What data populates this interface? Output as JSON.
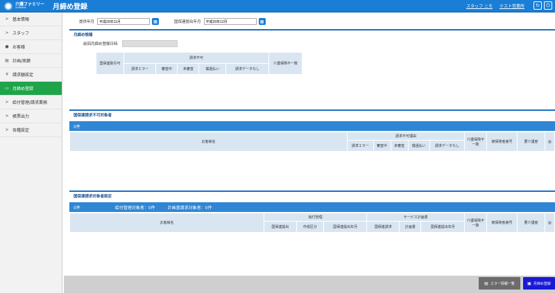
{
  "header": {
    "logo_brand": "介護ファミリー",
    "logo_sub": "Softbank",
    "title": "月締め登録",
    "user_link": "スタッフ ニモ",
    "office_link": "テスト営業所",
    "icons": [
      "refresh-icon",
      "power-icon"
    ]
  },
  "sidebar": {
    "items": [
      {
        "icon": ">",
        "label": "基本情報"
      },
      {
        "icon": ">",
        "label": "スタッフ"
      },
      {
        "icon": "●",
        "label": "お客様"
      },
      {
        "icon": "▤",
        "label": "計画/実績"
      },
      {
        "icon": "¥",
        "label": "請求額設定"
      },
      {
        "icon": "▭",
        "label": "月締め登録"
      },
      {
        "icon": ">",
        "label": "給付管理/請求業務"
      },
      {
        "icon": ">",
        "label": "帳票出力"
      },
      {
        "icon": ">",
        "label": "各種設定"
      }
    ],
    "active_index": 5
  },
  "filters": {
    "service_month_label": "提供年月",
    "service_month_value": "平成29年11月",
    "submit_month_label": "国保連提出年月",
    "submit_month_value": "平成29年12月"
  },
  "section1": {
    "title": "月締め情報",
    "last_close_label": "前回月締め登録日時",
    "last_close_value": "",
    "col_kokuho": "国保連取引可",
    "col_seikyu_fuka": "請求不可",
    "sub_cols": [
      "請求エラー",
      "審査中",
      "未審査",
      "償還払い",
      "請求データなし"
    ],
    "col_kaigo_mismatch": "介護保険不一致"
  },
  "section2": {
    "title": "国保連請求不可対象者",
    "count_label": "0件",
    "col_customer": "お客様名",
    "col_reason": "請求不可理由",
    "sub_cols": [
      "請求エラー",
      "審査中",
      "未審査",
      "償還払い",
      "請求データなし"
    ],
    "col_mismatch": "介護保険不一致",
    "col_insured_no": "被保険者番号",
    "col_care_level": "要介護度"
  },
  "section3": {
    "title": "国保連請求対象者設定",
    "count_label": "0件",
    "kyufu_label": "給付管理対象者：0件",
    "keikaku_label": "計画書請求対象者：0件",
    "col_customer": "お客様名",
    "col_kyufu": "給付管理",
    "kyufu_sub": [
      "国保連提出",
      "作成区分",
      "国保連提出年月"
    ],
    "col_service_plan": "サービス計画書",
    "plan_sub": [
      "国保連請求",
      "計画書",
      "国保連提出年月"
    ],
    "col_mismatch": "介護保険不一致",
    "col_insured_no": "被保険者番号",
    "col_care_level": "要介護度"
  },
  "footer": {
    "error_list_label": "エラー情報一覧",
    "register_label": "月締め登録"
  },
  "colors": {
    "header_blue": "#1a7ed6",
    "active_green": "#1fa44a",
    "band_blue": "#2f86d4",
    "register_blue": "#1a1ad6"
  }
}
